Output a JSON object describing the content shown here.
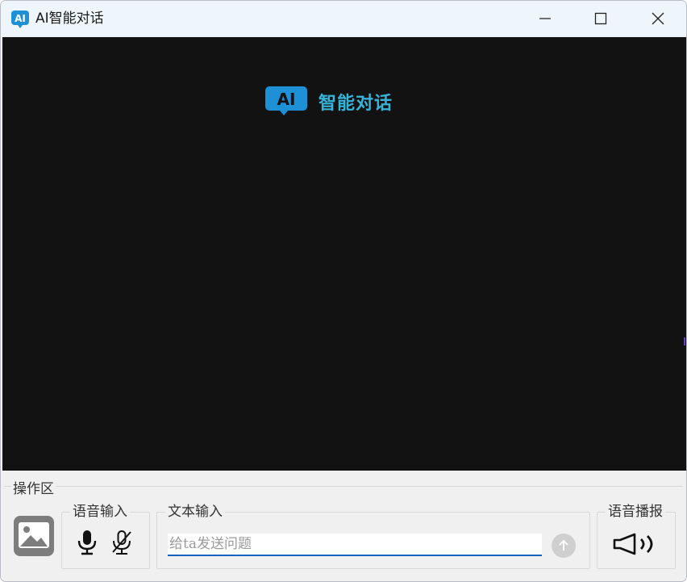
{
  "window": {
    "title": "AI智能对话",
    "icon": "ai-chat-bubble-icon"
  },
  "stage": {
    "logo_text": "AI",
    "headline": "智能对话"
  },
  "controls": {
    "section_label": "操作区",
    "voice_group_label": "语音输入",
    "text_group_label": "文本输入",
    "speak_group_label": "语音播报",
    "text_placeholder": "给ta发送问题",
    "text_value": ""
  },
  "colors": {
    "accent": "#37b3d8",
    "logo_blue": "#1e90d6",
    "input_underline": "#1565c0",
    "stage_bg": "#121212"
  },
  "icons": {
    "minimize": "minimize-icon",
    "maximize": "maximize-icon",
    "close": "close-icon",
    "image": "image-icon",
    "mic": "microphone-icon",
    "mic_off": "microphone-off-icon",
    "send": "arrow-up-icon",
    "speaker": "speaker-icon"
  }
}
